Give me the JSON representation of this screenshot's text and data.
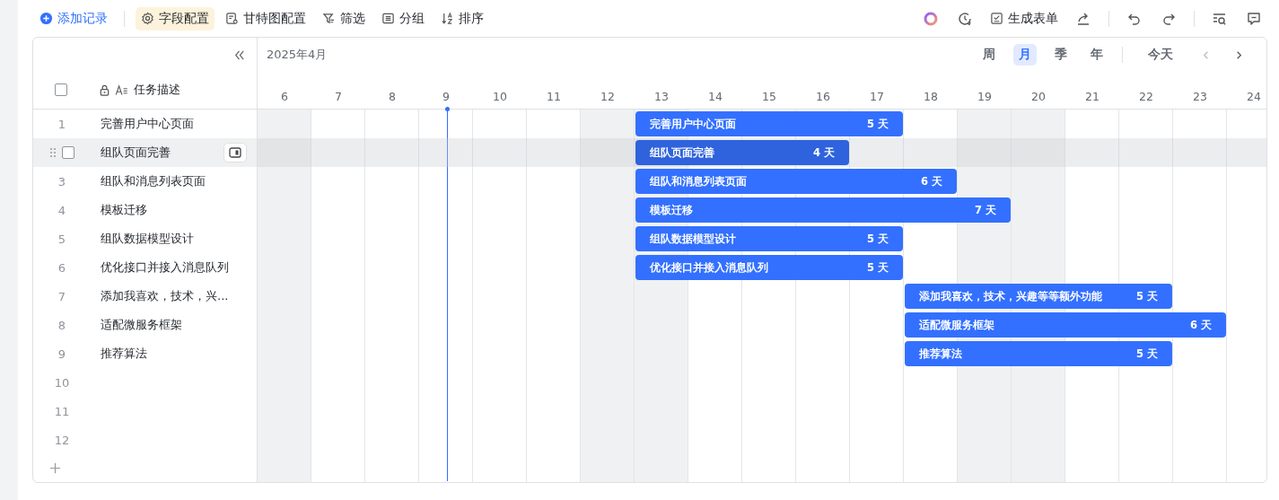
{
  "toolbar": {
    "left": [
      {
        "kind": "add",
        "label": "添加记录",
        "selected": false
      },
      {
        "kind": "gear",
        "label": "字段配置",
        "selected": true
      },
      {
        "kind": "doc",
        "label": "甘特图配置",
        "selected": false
      },
      {
        "kind": "filter",
        "label": "筛选",
        "selected": false
      },
      {
        "kind": "group",
        "label": "分组",
        "selected": false
      },
      {
        "kind": "sort",
        "label": "排序",
        "selected": false
      }
    ],
    "right_form": {
      "label": "生成表单"
    }
  },
  "gantt": {
    "month": "2025年4月",
    "views": [
      {
        "label": "周",
        "selected": false
      },
      {
        "label": "月",
        "selected": true
      },
      {
        "label": "季",
        "selected": false
      },
      {
        "label": "年",
        "selected": false
      }
    ],
    "today": "今天",
    "column": "任务描述",
    "select_all_checked": false,
    "days": [
      {
        "label": "6",
        "weekend": true,
        "today": false
      },
      {
        "label": "7",
        "weekend": false,
        "today": false
      },
      {
        "label": "8",
        "weekend": false,
        "today": false
      },
      {
        "label": "9",
        "weekend": false,
        "today": true
      },
      {
        "label": "10",
        "weekend": false,
        "today": false
      },
      {
        "label": "11",
        "weekend": false,
        "today": false
      },
      {
        "label": "12",
        "weekend": true,
        "today": false
      },
      {
        "label": "13",
        "weekend": true,
        "today": false
      },
      {
        "label": "14",
        "weekend": false,
        "today": false
      },
      {
        "label": "15",
        "weekend": false,
        "today": false
      },
      {
        "label": "16",
        "weekend": false,
        "today": false
      },
      {
        "label": "17",
        "weekend": false,
        "today": false
      },
      {
        "label": "18",
        "weekend": false,
        "today": false
      },
      {
        "label": "19",
        "weekend": true,
        "today": false
      },
      {
        "label": "20",
        "weekend": true,
        "today": false
      },
      {
        "label": "21",
        "weekend": false,
        "today": false
      },
      {
        "label": "22",
        "weekend": false,
        "today": false
      },
      {
        "label": "23",
        "weekend": false,
        "today": false
      },
      {
        "label": "24",
        "weekend": false,
        "today": false
      }
    ],
    "rows": [
      {
        "num": "1",
        "name": "完善用户中心页面",
        "hovered": false,
        "checked": false,
        "bar": {
          "label": "完善用户中心页面",
          "duration": "5 天"
        }
      },
      {
        "name": "组队页面完善",
        "hovered": true,
        "checked": false,
        "bar": {
          "label": "组队页面完善",
          "duration": "4 天"
        }
      },
      {
        "num": "3",
        "name": "组队和消息列表页面",
        "hovered": false,
        "checked": false,
        "bar": {
          "label": "组队和消息列表页面",
          "duration": "6 天"
        }
      },
      {
        "num": "4",
        "name": "模板迁移",
        "hovered": false,
        "checked": false,
        "bar": {
          "label": "模板迁移",
          "duration": "7 天"
        }
      },
      {
        "num": "5",
        "name": "组队数据模型设计",
        "hovered": false,
        "checked": false,
        "bar": {
          "label": "组队数据模型设计",
          "duration": "5 天"
        }
      },
      {
        "num": "6",
        "name": "优化接口并接入消息队列",
        "hovered": false,
        "checked": false,
        "bar": {
          "label": "优化接口并接入消息队列",
          "duration": "5 天"
        }
      },
      {
        "num": "7",
        "name": "添加我喜欢，技术，兴...",
        "hovered": false,
        "checked": false,
        "bar": {
          "label": "添加我喜欢，技术，兴趣等等额外功能",
          "duration": "5 天"
        }
      },
      {
        "num": "8",
        "name": "适配微服务框架",
        "hovered": false,
        "checked": false,
        "bar": {
          "label": "适配微服务框架",
          "duration": "6 天"
        }
      },
      {
        "num": "9",
        "name": "推荐算法",
        "hovered": false,
        "checked": false,
        "bar": {
          "label": "推荐算法",
          "duration": "5 天"
        }
      },
      {
        "num": "10",
        "hovered": false,
        "checked": false
      },
      {
        "num": "11",
        "hovered": false,
        "checked": false
      },
      {
        "num": "12",
        "hovered": false,
        "checked": false
      }
    ]
  }
}
